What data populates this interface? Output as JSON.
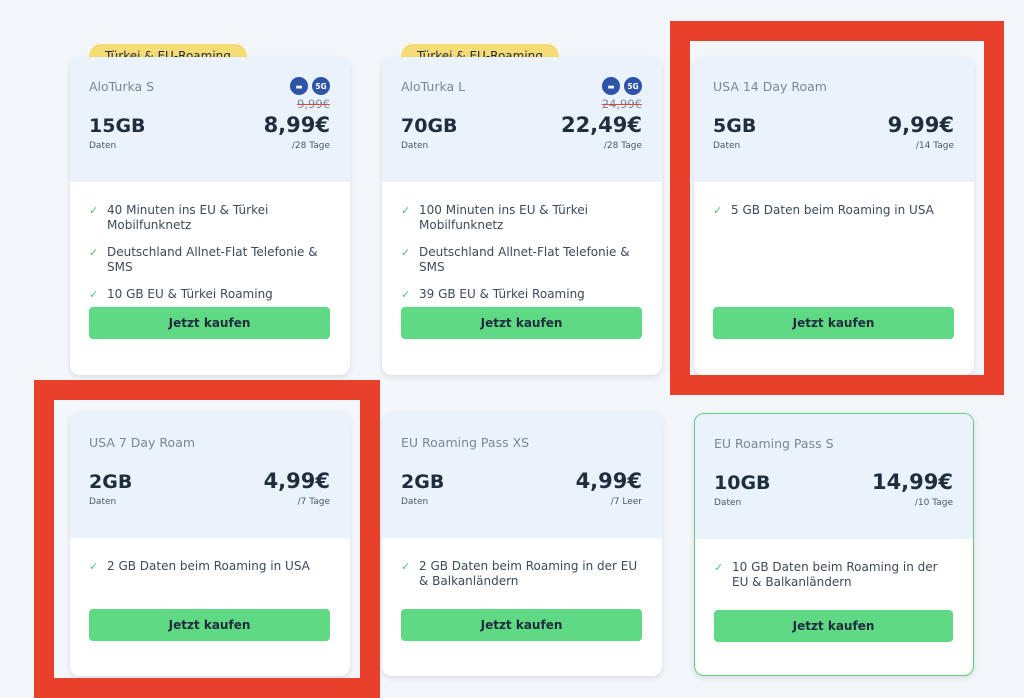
{
  "colors": {
    "accent_green": "#5fd983",
    "badge_yellow": "#f6dc74",
    "highlight_red": "#e8412b",
    "header_blue": "#eaf3fb"
  },
  "cards": [
    {
      "badge": "Türkei & EU-Roaming",
      "name": "AloTurka S",
      "gb": "15GB",
      "gb_label": "Daten",
      "old_price": "9,99€",
      "price": "8,99€",
      "period": "/28 Tage",
      "icons": [
        "sim-icon",
        "5g-icon"
      ],
      "icon_labels": [
        "▬",
        "5G"
      ],
      "features": [
        "40 Minuten ins EU & Türkei Mobilfunknetz",
        "Deutschland Allnet-Flat Telefonie & SMS",
        "10 GB EU & Türkei Roaming"
      ],
      "button": "Jetzt kaufen"
    },
    {
      "badge": "Türkei & EU-Roaming",
      "name": "AloTurka L",
      "gb": "70GB",
      "gb_label": "Daten",
      "old_price": "24,99€",
      "price": "22,49€",
      "period": "/28 Tage",
      "icons": [
        "sim-icon",
        "5g-icon"
      ],
      "icon_labels": [
        "▬",
        "5G"
      ],
      "features": [
        "100 Minuten ins EU & Türkei Mobilfunknetz",
        "Deutschland Allnet-Flat Telefonie & SMS",
        "39 GB EU & Türkei Roaming"
      ],
      "button": "Jetzt kaufen"
    },
    {
      "name": "USA 14 Day Roam",
      "gb": "5GB",
      "gb_label": "Daten",
      "price": "9,99€",
      "period": "/14 Tage",
      "features": [
        "5 GB Daten beim Roaming in USA"
      ],
      "button": "Jetzt kaufen"
    },
    {
      "name": "USA 7 Day Roam",
      "gb": "2GB",
      "gb_label": "Daten",
      "price": "4,99€",
      "period": "/7 Tage",
      "features": [
        "2 GB Daten beim Roaming in USA"
      ],
      "button": "Jetzt kaufen"
    },
    {
      "name": "EU Roaming Pass XS",
      "gb": "2GB",
      "gb_label": "Daten",
      "price": "4,99€",
      "period": "/7 Leer",
      "features": [
        "2 GB Daten beim Roaming in der EU & Balkanländern"
      ],
      "button": "Jetzt kaufen"
    },
    {
      "name": "EU Roaming Pass S",
      "gb": "10GB",
      "gb_label": "Daten",
      "price": "14,99€",
      "period": "/10 Tage",
      "features": [
        "10 GB Daten beim Roaming in der EU & Balkanländern"
      ],
      "button": "Jetzt kaufen"
    }
  ]
}
